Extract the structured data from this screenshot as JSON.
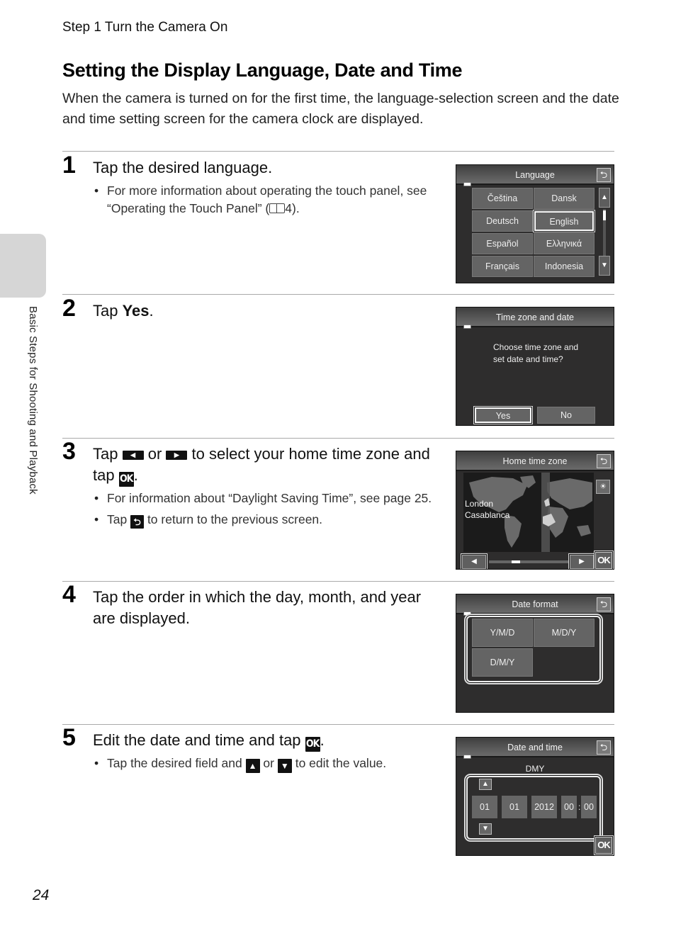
{
  "running_head": "Step 1 Turn the Camera On",
  "section_title": "Setting the Display Language, Date and Time",
  "intro": "When the camera is turned on for the first time, the language-selection screen and the date and time setting screen for the camera clock are displayed.",
  "side_label": "Basic Steps for Shooting and Playback",
  "page_number": "24",
  "steps": [
    {
      "number": "1",
      "title": "Tap the desired language.",
      "bullets": [
        {
          "text_before": "For more information about operating the touch panel, see “Operating the Touch Panel” (",
          "ref": "4",
          "text_after": ")."
        }
      ]
    },
    {
      "number": "2",
      "title_prefix": "Tap ",
      "title_bold": "Yes",
      "title_suffix": "."
    },
    {
      "number": "3",
      "title_parts": [
        "Tap ",
        " or ",
        " to select your home time zone and tap ",
        "."
      ],
      "icons": [
        "left-arrow",
        "right-arrow",
        "ok"
      ],
      "bullets": [
        {
          "text": "For information about “Daylight Saving Time”, see page 25."
        },
        {
          "text_before": "Tap ",
          "text_after": " to return to the previous screen."
        }
      ]
    },
    {
      "number": "4",
      "title": "Tap the order in which the day, month, and year are displayed."
    },
    {
      "number": "5",
      "title_prefix": "Edit the date and time and tap ",
      "title_suffix": ".",
      "bullets": [
        {
          "parts": [
            "Tap the desired field and ",
            " or ",
            " to edit the value."
          ]
        }
      ]
    }
  ],
  "icons": {
    "left_arrow": "◀",
    "right_arrow": "▶",
    "ok": "OK",
    "back": "⮌",
    "up": "▲",
    "down": "▼"
  },
  "screens": {
    "language": {
      "title": "Language",
      "options": [
        "Čeština",
        "Dansk",
        "Deutsch",
        "English",
        "Español",
        "Ελληνικά",
        "Français",
        "Indonesia"
      ],
      "selected": "English"
    },
    "time_zone_date": {
      "title": "Time zone and date",
      "message_line1": "Choose time zone and",
      "message_line2": "set date and time?",
      "yes": "Yes",
      "no": "No",
      "selected": "Yes"
    },
    "home_time_zone": {
      "title": "Home time zone",
      "city1": "London",
      "city2": "Casablanca"
    },
    "date_format": {
      "title": "Date format",
      "options": [
        "Y/M/D",
        "M/D/Y",
        "D/M/Y"
      ]
    },
    "date_time": {
      "title": "Date and time",
      "order_label": "DMY",
      "day": "01",
      "month": "01",
      "year": "2012",
      "hour": "00",
      "separator": ":",
      "minute": "00"
    }
  }
}
